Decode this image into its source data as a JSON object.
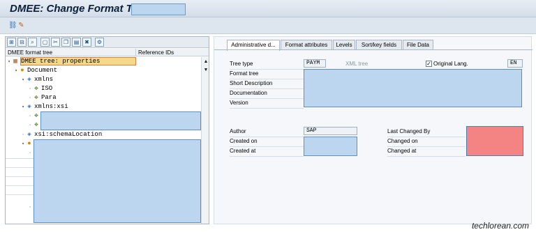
{
  "title": {
    "text": "DMEE: Change Format Tree"
  },
  "app_toolbar": {
    "icons": [
      "hierarchy-icon",
      "pencil-icon"
    ]
  },
  "left_pane": {
    "toolbar_icons": [
      "expand-all-icon",
      "collapse-all-icon",
      "find-icon",
      "new-node-icon",
      "cut-icon",
      "copy-icon",
      "paste-icon",
      "delete-icon",
      "structure-icon"
    ],
    "columns": [
      "DMEE format tree",
      "Reference IDs"
    ],
    "tree": [
      {
        "label": "DMEE tree: properties",
        "icon": "tree-root-icon",
        "selected": true
      },
      {
        "label": "Document",
        "icon": "element-icon"
      },
      {
        "label": "xmlns",
        "icon": "attribute-icon"
      },
      {
        "label": "ISO",
        "icon": "constant-icon"
      },
      {
        "label": "Para",
        "icon": "constant-icon"
      },
      {
        "label": "xmlns:xsi",
        "icon": "attribute-icon"
      },
      {
        "label": "xsi:schemaLocation",
        "icon": "attribute-icon"
      }
    ]
  },
  "tabs": [
    "Administrative d...",
    "Format attributes",
    "Levels",
    "Sort/key fields",
    "File Data"
  ],
  "admin": {
    "tree_type_label": "Tree type",
    "tree_type_value": "PAYM",
    "xml_tree_label": "XML tree",
    "original_lang_label": "Original Lang.",
    "original_lang_checked": true,
    "lang_value": "EN",
    "format_tree_label": "Format tree",
    "short_description_label": "Short Description",
    "documentation_label": "Documentation",
    "version_label": "Version",
    "author_label": "Author",
    "author_value": "SAP",
    "created_on_label": "Created on",
    "created_at_label": "Created at",
    "last_changed_by_label": "Last Changed By",
    "changed_on_label": "Changed on",
    "changed_at_label": "Changed at"
  },
  "watermark": "techlorean.com",
  "colors": {
    "redaction_blue": "#bcd6f0",
    "redaction_red": "#f48383",
    "selection": "#f5d98a"
  }
}
